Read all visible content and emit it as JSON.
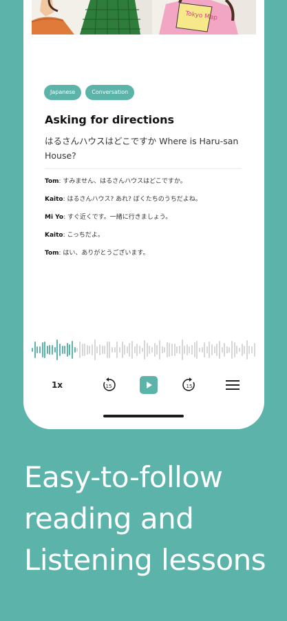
{
  "lesson": {
    "tags": [
      "Japanese",
      "Conversation"
    ],
    "title": "Asking for directions",
    "subtitle": "はるさんハウスはどこですか Where is Haru-san House?",
    "dialogue": [
      {
        "speaker": "Tom",
        "text": ": すみません、はるさんハウスはどこですか。"
      },
      {
        "speaker": "Kaito",
        "text": ": はるさんハウス? あれ? ぼくたちのうちだよね。"
      },
      {
        "speaker": "Mi Yo",
        "text": ": すぐ近くです。一緒に行きましょう。"
      },
      {
        "speaker": "Kaito",
        "text": ": こっちだよ。"
      },
      {
        "speaker": "Tom",
        "text": ": はい、ありがとうございます。"
      }
    ]
  },
  "player": {
    "speed_label": "1x",
    "rewind_label": "15",
    "forward_label": "15",
    "progress_fraction": 0.2
  },
  "caption": {
    "line1": "Easy-to-follow",
    "line2": "reading and",
    "line3": "Listening lessons"
  },
  "colors": {
    "accent": "#5bb3aa",
    "played_wave": "#5bb3aa",
    "unplayed_wave": "#d6d6d6"
  },
  "icons": [
    "rewind-15-icon",
    "play-icon",
    "forward-15-icon",
    "menu-icon"
  ]
}
